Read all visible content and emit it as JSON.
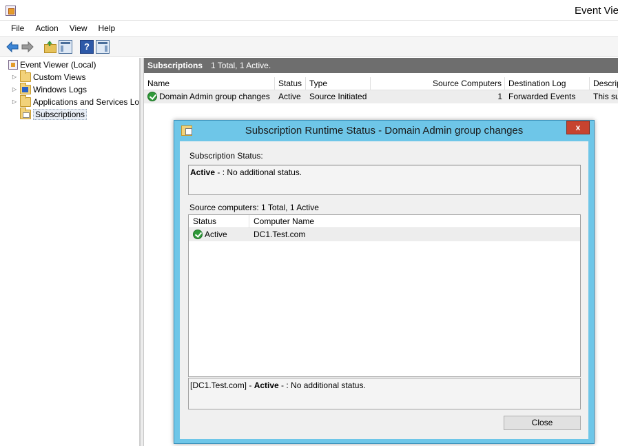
{
  "window": {
    "title": "Event Viewer"
  },
  "menu": [
    "File",
    "Action",
    "View",
    "Help"
  ],
  "toolbar": {
    "help_glyph": "?"
  },
  "tree": {
    "root": "Event Viewer (Local)",
    "items": [
      "Custom Views",
      "Windows Logs",
      "Applications and Services Lo",
      "Subscriptions"
    ]
  },
  "right": {
    "header_title": "Subscriptions",
    "header_summary": "1 Total, 1 Active.",
    "columns": [
      "Name",
      "Status",
      "Type",
      "Source Computers",
      "Destination Log",
      "Descrip"
    ],
    "rows": [
      {
        "name": "Domain Admin group changes",
        "status": "Active",
        "type": "Source Initiated",
        "source_computers": "1",
        "destination_log": "Forwarded Events",
        "description": "This su"
      }
    ]
  },
  "dialog": {
    "title": "Subscription Runtime Status - Domain Admin group changes",
    "close_glyph": "x",
    "status_label": "Subscription Status:",
    "status_bold": "Active",
    "status_rest": " - : No additional status.",
    "source_label": "Source computers: 1 Total, 1 Active",
    "grid_columns": [
      "Status",
      "Computer Name"
    ],
    "grid_rows": [
      {
        "status": "Active",
        "computer": "DC1.Test.com"
      }
    ],
    "detail_prefix": "[DC1.Test.com] - ",
    "detail_bold": "Active",
    "detail_rest": " - : No additional status.",
    "close_button": "Close"
  }
}
